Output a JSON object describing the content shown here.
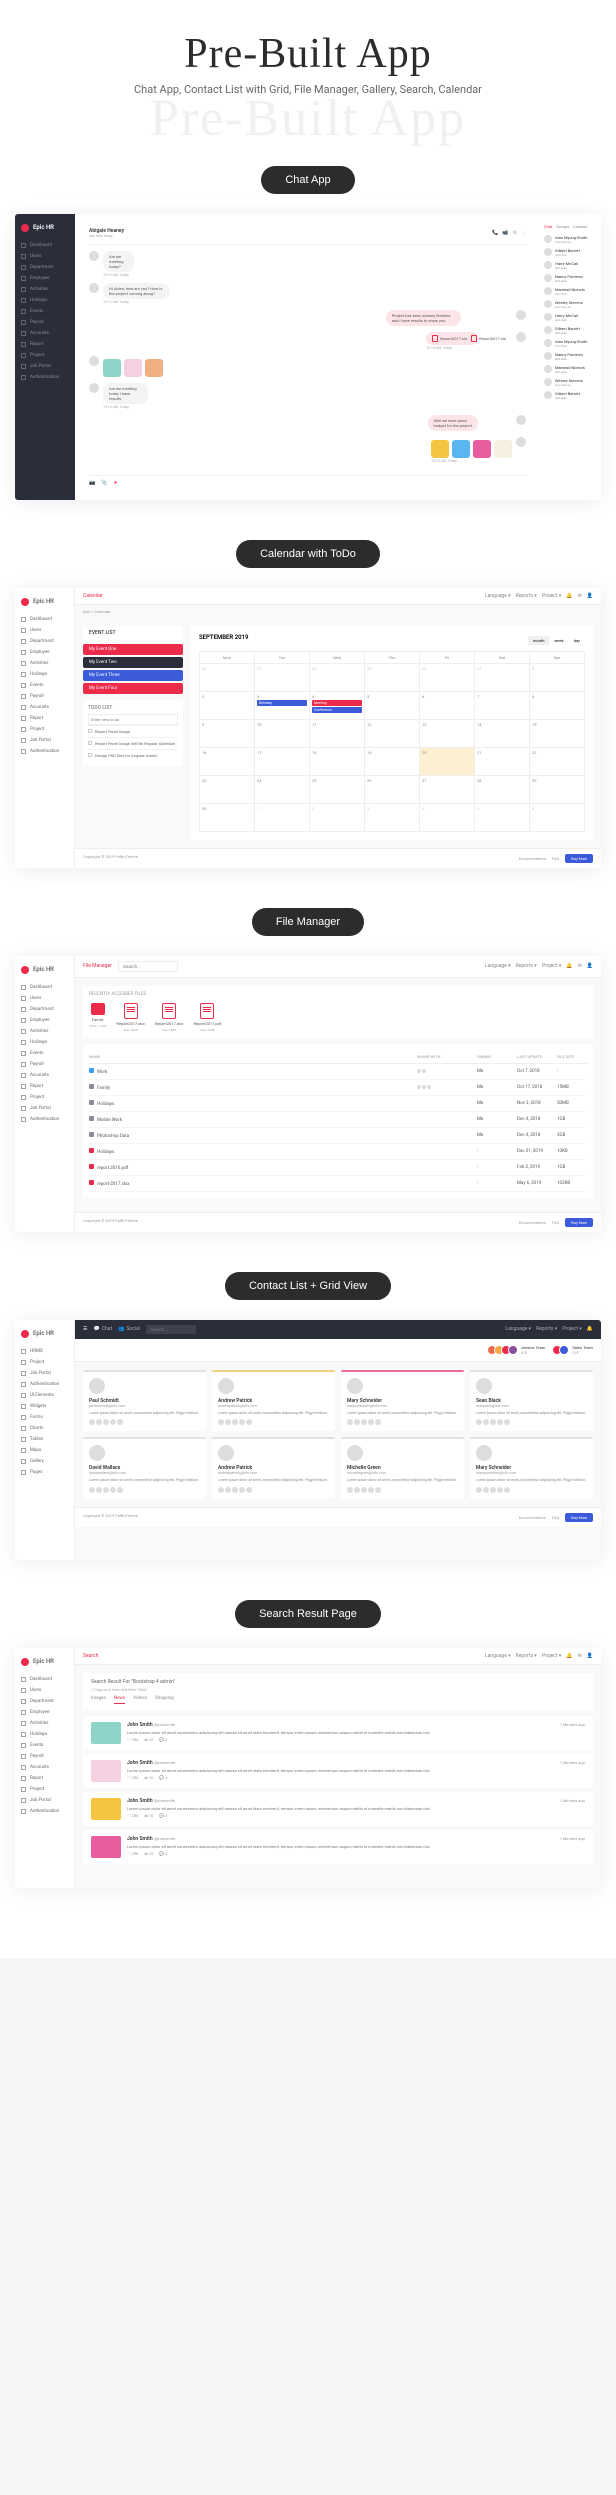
{
  "header": {
    "title": "Pre-Built App",
    "subtitle": "Chat App, Contact List with Grid, File Manager,\nGallery, Search, Calendar",
    "watermark": "Pre-Built App"
  },
  "pills": [
    "Chat App",
    "Calendar with ToDo",
    "File Manager",
    "Contact List + Grid View",
    "Search Result Page"
  ],
  "brand": "Epic HR",
  "nav_dark": [
    "Dashboard",
    "Users",
    "Department",
    "Employee",
    "Activities",
    "Holidays",
    "Events",
    "Payroll",
    "Accounts",
    "Report",
    "Project",
    "Job Portal",
    "Authentication"
  ],
  "nav_light": [
    "Dashboard",
    "Users",
    "Department",
    "Employee",
    "Activities",
    "Holidays",
    "Events",
    "Payroll",
    "Accounts",
    "Report",
    "Project",
    "Job Portal",
    "Authentication"
  ],
  "nav_contacts": [
    "HRMS",
    "Project",
    "Job Portal",
    "Authentication",
    "UI Elements",
    "Widgets",
    "Forms",
    "Charts",
    "Tables",
    "Maps",
    "Gallery",
    "Pages"
  ],
  "topbar": {
    "language": "Language ▾",
    "reports": "Reports ▾",
    "project": "Project ▾"
  },
  "chat": {
    "header_name": "Abigale Heaney",
    "header_status": "last seen today",
    "messages": [
      {
        "side": "left",
        "text": "Are we meeting today?",
        "time": "10:12 AM, Today"
      },
      {
        "side": "left",
        "text": "Hi Aiden, how are you? How is the project coming along?",
        "time": "10:12 AM, Today"
      },
      {
        "side": "right",
        "text": "Project has been already finished and I have results to show you.",
        "time": ""
      },
      {
        "side": "right",
        "attachments": [
          "Report2017.xls",
          "Report2017.xls"
        ],
        "time": "10:16 AM, Today"
      },
      {
        "side": "left",
        "images": [
          "#8ed4c9",
          "#f5d0e0",
          "#f0b080"
        ],
        "time": ""
      },
      {
        "side": "left",
        "text": "Are we meeting today I have results",
        "time": "10:16 AM, Today"
      },
      {
        "side": "right",
        "text": "Well we have good budget for the project",
        "time": ""
      },
      {
        "side": "right",
        "images": [
          "#f5c542",
          "#5bb5f0",
          "#e85d9e",
          "#f5f0e0"
        ],
        "time": "10:16 AM, Today"
      }
    ],
    "contacts_tabs": [
      "Chat",
      "Groups",
      "Contact"
    ],
    "contacts": [
      {
        "name": "Alan Myung-Smith",
        "msg": "how are you"
      },
      {
        "name": "Gilbert Barrett",
        "msg": "I am fine"
      },
      {
        "name": "Harry McCall",
        "msg": "last seen"
      },
      {
        "name": "Nanny Pomeroy",
        "msg": "last seen"
      },
      {
        "name": "Marshall Nichols",
        "msg": "I am fine"
      },
      {
        "name": "Wesley Stevens",
        "msg": "how are you"
      },
      {
        "name": "Harry McCall",
        "msg": "last seen"
      },
      {
        "name": "Gilbert Barrett",
        "msg": "last seen"
      },
      {
        "name": "Alan Myung-Smith",
        "msg": "I am fine"
      },
      {
        "name": "Nanny Pomeroy",
        "msg": "last seen"
      },
      {
        "name": "Marshall Nichols",
        "msg": "last seen"
      },
      {
        "name": "Wesley Stevens",
        "msg": "how are you"
      },
      {
        "name": "Gilbert Barrett",
        "msg": "last seen"
      }
    ]
  },
  "calendar": {
    "page_title": "Calendar",
    "breadcrumb": "Epic > Calendar",
    "events_title": "EVENT LIST",
    "events": [
      {
        "label": "My Event One",
        "color": "#ec2b4b"
      },
      {
        "label": "My Event Two",
        "color": "#2a2d3a"
      },
      {
        "label": "My Event Three",
        "color": "#3b5bdb"
      },
      {
        "label": "My Event Four",
        "color": "#ec2b4b"
      }
    ],
    "todo_title": "TODO LIST",
    "todo_input": "Enter new to-do",
    "todos": [
      "Report Panel Usage",
      "Report Panel Usage Will Be Regular Schedule",
      "Design PSD files for Angular Admin"
    ],
    "month": "SEPTEMBER 2019",
    "view_tabs": [
      "month",
      "week",
      "day"
    ],
    "dow": [
      "Mon",
      "Tue",
      "Wed",
      "Thu",
      "Fri",
      "Sat",
      "Sun"
    ],
    "cells": [
      {
        "d": "26",
        "other": true
      },
      {
        "d": "27",
        "other": true
      },
      {
        "d": "28",
        "other": true
      },
      {
        "d": "29",
        "other": true
      },
      {
        "d": "30",
        "other": true
      },
      {
        "d": "31",
        "other": true
      },
      {
        "d": "1"
      },
      {
        "d": "2"
      },
      {
        "d": "3",
        "ev": [
          {
            "t": "Birthday",
            "c": "#3b5bdb"
          }
        ]
      },
      {
        "d": "4",
        "ev": [
          {
            "t": "Meeting",
            "c": "#ec2b4b"
          },
          {
            "t": "Conference",
            "c": "#3b5bdb"
          }
        ]
      },
      {
        "d": "5"
      },
      {
        "d": "6"
      },
      {
        "d": "7"
      },
      {
        "d": "8"
      },
      {
        "d": "9"
      },
      {
        "d": "10"
      },
      {
        "d": "11"
      },
      {
        "d": "12"
      },
      {
        "d": "13"
      },
      {
        "d": "14"
      },
      {
        "d": "15"
      },
      {
        "d": "16"
      },
      {
        "d": "17"
      },
      {
        "d": "18"
      },
      {
        "d": "19"
      },
      {
        "d": "20",
        "hl": "#f5c542"
      },
      {
        "d": "21"
      },
      {
        "d": "22"
      },
      {
        "d": "23"
      },
      {
        "d": "24"
      },
      {
        "d": "25"
      },
      {
        "d": "26"
      },
      {
        "d": "27"
      },
      {
        "d": "28"
      },
      {
        "d": "29"
      },
      {
        "d": "30"
      },
      {
        "d": "1",
        "other": true
      },
      {
        "d": "2",
        "other": true
      },
      {
        "d": "3",
        "other": true
      },
      {
        "d": "4",
        "other": true
      },
      {
        "d": "5",
        "other": true
      },
      {
        "d": "6",
        "other": true
      }
    ]
  },
  "filemanager": {
    "page_title": "File Manager",
    "search_placeholder": "Search...",
    "recent_title": "RECENTLY ACCESSED FILES",
    "recent": [
      {
        "type": "folder",
        "name": "Family",
        "meta": "3 files, 1.2GB"
      },
      {
        "type": "pdf",
        "name": "Report2017.doc",
        "meta": "Size: 68KB"
      },
      {
        "type": "pdf",
        "name": "Report2017.doc",
        "meta": "Size: 68KB"
      },
      {
        "type": "pdf",
        "name": "Report2017.pdf",
        "meta": "Size: 68KB"
      }
    ],
    "columns": [
      "NAME",
      "SHARE WITH",
      "OWNER",
      "LAST UPDATE",
      "FILE SIZE"
    ],
    "rows": [
      {
        "icon": "#3b9eff",
        "name": "Work",
        "share": 2,
        "owner": "Me",
        "date": "Oct 7, 2018",
        "size": "-"
      },
      {
        "icon": "#8a8d99",
        "name": "Family",
        "share": 3,
        "owner": "Me",
        "date": "Oct 17, 2018",
        "size": "15MB"
      },
      {
        "icon": "#8a8d99",
        "name": "Holidays",
        "share": 0,
        "owner": "Me",
        "date": "Nov 3, 2018",
        "size": "50MB"
      },
      {
        "icon": "#8a8d99",
        "name": "Mobile Work",
        "share": 0,
        "owner": "Me",
        "date": "Dec 4, 2018",
        "size": "1GB"
      },
      {
        "icon": "#8a8d99",
        "name": "Photoshop Data",
        "share": 0,
        "owner": "Me",
        "date": "Dec 4, 2018",
        "size": "3GB"
      },
      {
        "icon": "#ec2b4b",
        "name": "Holidays",
        "share": 0,
        "owner": "-",
        "date": "Dec 21, 2019",
        "size": "10KB"
      },
      {
        "icon": "#ec2b4b",
        "name": "report.2016.pdf",
        "share": 0,
        "owner": "-",
        "date": "Feb 2, 2019",
        "size": "1GB"
      },
      {
        "icon": "#ec2b4b",
        "name": "report-2017.xlsx",
        "share": 0,
        "owner": "-",
        "date": "May 6, 2019",
        "size": "103KB"
      }
    ]
  },
  "contacts": {
    "bar_items": [
      "Chat",
      "Social"
    ],
    "teams": [
      {
        "label": "Jessica Team",
        "count": "4/5",
        "colors": [
          "#ec6b4b",
          "#f5a542",
          "#ec2b4b",
          "#8a4d99"
        ]
      },
      {
        "label": "Sales Team",
        "count": "2/5",
        "colors": [
          "#ec2b4b",
          "#3b5bdb"
        ]
      }
    ],
    "cards": [
      {
        "name": "Paul Schmidt",
        "email": "paulschmidt@info.com",
        "desc": "Lorem ipsum dolor sit amet, consectetur adipiscing elit. Pligyl medium.",
        "accent": "#e0e0e0"
      },
      {
        "name": "Andrew Patrick",
        "email": "andrewpatrick@info.com",
        "desc": "Lorem ipsum dolor sit amet, consectetur adipiscing elit. Pligyl medium.",
        "accent": "#f0d080"
      },
      {
        "name": "Mary Schneider",
        "email": "maryschneider@info.com",
        "desc": "Lorem ipsum dolor sit amet, consectetur adipiscing elit. Pligyl medium.",
        "accent": "#ec6b9b"
      },
      {
        "name": "Sean Black",
        "email": "seanblack@info.com",
        "desc": "Lorem ipsum dolor sit amet, consectetur adipiscing elit. Pligyl medium.",
        "accent": "#e0e0e0"
      },
      {
        "name": "David Wallace",
        "email": "davidwallace@info.com",
        "desc": "Lorem ipsum dolor sit amet, consectetur adipiscing elit. Pligyl medium.",
        "accent": "#e0e0e0"
      },
      {
        "name": "Andrew Patrick",
        "email": "andrewpatrick@info.com",
        "desc": "Lorem ipsum dolor sit amet, consectetur adipiscing elit. Pligyl medium.",
        "accent": "#e0e0e0"
      },
      {
        "name": "Michelle Green",
        "email": "michellegreen@info.com",
        "desc": "Lorem ipsum dolor sit amet, consectetur adipiscing elit. Pligyl medium.",
        "accent": "#e0e0e0"
      },
      {
        "name": "Mary Schneider",
        "email": "maryschneider@info.com",
        "desc": "Lorem ipsum dolor sit amet, consectetur adipiscing elit. Pligyl medium.",
        "accent": "#e0e0e0"
      }
    ]
  },
  "search": {
    "page_title": "Search",
    "result_text": "Search Result For \"Bootstrap 4 admin\"",
    "filter_label": "1 Page and Selected filter \"Web\"",
    "tabs": [
      "Images",
      "News",
      "Videos",
      "Shopping"
    ],
    "results": [
      {
        "thumb": "#8ed4c9",
        "title": "John Smith",
        "handle": "@johnsmith",
        "desc": "Lorem ipsum dolor sit amet consectetur adipiscing elit massa sit amet diam hendrerit, tempor lorem ipsum, elementum augue mattis et molestie mattis non bibendum nisl.",
        "time": "1 Minutes ago"
      },
      {
        "thumb": "#f5d0e0",
        "title": "John Smith",
        "handle": "@johnsmith",
        "desc": "Lorem ipsum dolor sit amet consectetur adipiscing elit massa sit amet diam hendrerit, tempor lorem ipsum, elementum augue mattis et molestie mattis non bibendum nisl.",
        "time": "1 Minutes ago"
      },
      {
        "thumb": "#f5c542",
        "title": "John Smith",
        "handle": "@johnsmith",
        "desc": "Lorem ipsum dolor sit amet consectetur adipiscing elit massa sit amet diam hendrerit, tempor lorem ipsum, elementum augue mattis et molestie mattis non bibendum nisl.",
        "time": "1 Minutes ago"
      },
      {
        "thumb": "#e85d9e",
        "title": "John Smith",
        "handle": "@johnsmith",
        "desc": "Lorem ipsum dolor sit amet consectetur adipiscing elit massa sit amet diam hendrerit, tempor lorem ipsum, elementum augue mattis et molestie mattis non bibendum nisl.",
        "time": "1 Minutes ago"
      }
    ],
    "actions": {
      "like": "256",
      "share": "16",
      "comment": "4"
    }
  },
  "footer": {
    "copyright": "Copyright © 2019 PuffinTheme",
    "docs": "Documentation",
    "faq": "FAQ",
    "buy": "Buy Now"
  }
}
